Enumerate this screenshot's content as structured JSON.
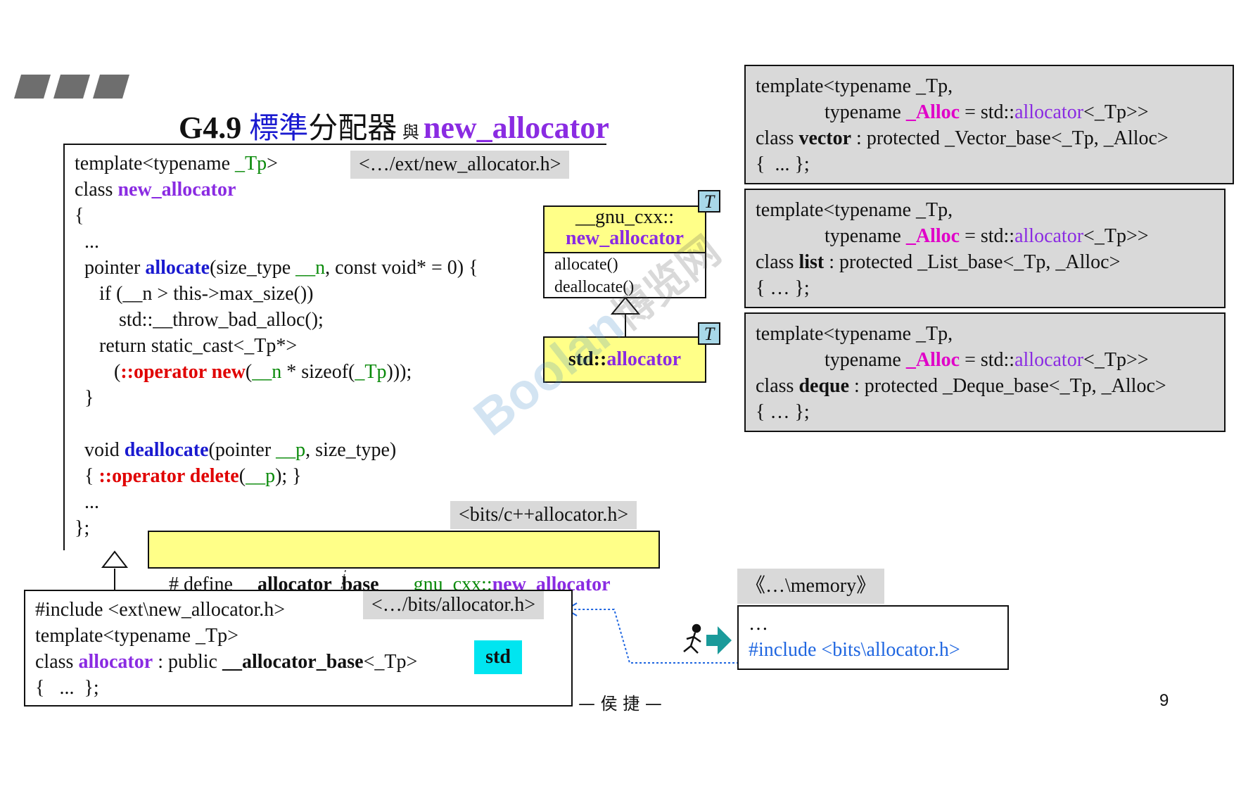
{
  "title": {
    "prefix": "G4.9 ",
    "cjk_blue": "標準",
    "cjk_black": "分配器",
    "connector": "與",
    "highlight": "new_allocator"
  },
  "new_allocator_box": {
    "header_label": "<…/ext/new_allocator.h>",
    "code": {
      "l1_a": "template<typename ",
      "l1_b": "_Tp",
      "l1_c": ">",
      "l2_a": "class ",
      "l2_b": "new_allocator",
      "l3": "{",
      "l4": "  ...",
      "l5_a": "  pointer ",
      "l5_b": "allocate",
      "l5_c": "(size_type ",
      "l5_d": "__n",
      "l5_e": ", const void* = 0) {",
      "l6": "     if (__n > this->max_size())",
      "l7": "         std::__throw_bad_alloc();",
      "l8": "     return static_cast<_Tp*>",
      "l9_a": "        (",
      "l9_b": "::operator new",
      "l9_c": "(",
      "l9_d": "__n",
      "l9_e": " * sizeof(",
      "l9_f": "_Tp",
      "l9_g": ")));",
      "l10": "  }",
      "l11_a": "  void ",
      "l11_b": "deallocate",
      "l11_c": "(pointer ",
      "l11_d": "__p",
      "l11_e": ", size_type)",
      "l12_a": "  { ",
      "l12_b": "::operator delete",
      "l12_c": "(",
      "l12_d": "__p",
      "l12_e": "); }",
      "l13": "  ...",
      "l14": "};"
    }
  },
  "uml": {
    "gnu_ns": "__gnu_cxx::",
    "gnu_class": "new_allocator",
    "method1": "allocate()",
    "method2": "deallocate()",
    "std_prefix": "std::",
    "std_class": "allocator",
    "template_tag": "T"
  },
  "cxx_allocator_label": "<bits/c++allocator.h>",
  "define_line": {
    "a": "# define ",
    "b": "__allocator_base",
    "c": "   __gnu_cxx::",
    "d": "new_allocator"
  },
  "allocator_box": {
    "header_label": "<…/bits/allocator.h>",
    "l1": "#include <ext\\new_allocator.h>",
    "l2": "template<typename _Tp>",
    "l3_a": "class ",
    "l3_b": "allocator",
    "l3_c": " : public ",
    "l3_d": "__allocator_base",
    "l3_e": "<_Tp>",
    "l4": "{   ...  };",
    "std_badge": "std"
  },
  "containers": [
    {
      "l1": "template<typename _Tp,",
      "l2_a": "              typename ",
      "l2_b": "_Alloc",
      "l2_c": " = std::",
      "l2_d": "allocator",
      "l2_e": "<_Tp>>",
      "l3_a": "class ",
      "l3_b": "vector",
      "l3_c": " : protected _Vector_base<_Tp, _Alloc>",
      "l4": "{  ... };"
    },
    {
      "l1": "template<typename _Tp,",
      "l2_a": "              typename ",
      "l2_b": "_Alloc",
      "l2_c": " = std::",
      "l2_d": "allocator",
      "l2_e": "<_Tp>>",
      "l3_a": "class ",
      "l3_b": "list",
      "l3_c": " : protected _List_base<_Tp, _Alloc>",
      "l4": "{ … };"
    },
    {
      "l1": "template<typename _Tp,",
      "l2_a": "              typename ",
      "l2_b": "_Alloc",
      "l2_c": " = std::",
      "l2_d": "allocator",
      "l2_e": "<_Tp>>",
      "l3_a": "class ",
      "l3_b": "deque",
      "l3_c": " : protected _Deque_base<_Tp, _Alloc>",
      "l4": "{ … };"
    }
  ],
  "memory_box": {
    "label": "《…\\memory》",
    "l1": "…",
    "l2": "#include <bits\\allocator.h>"
  },
  "footer": {
    "author": "— 侯 捷 —",
    "page": "9"
  },
  "watermark": {
    "brand": "Boolan",
    "cjk": "博览网"
  },
  "colors": {
    "accent_purple": "#8a2be2",
    "method_blue": "#1a1ad0",
    "operator_red": "#e00000",
    "param_green": "#0a8a0a",
    "alloc_magenta": "#e000c8",
    "box_yellow": "#ffff88",
    "label_gray": "#d9d9d9",
    "badge_cyan": "#00e5f0",
    "tag_blue": "#a8d8e8"
  }
}
